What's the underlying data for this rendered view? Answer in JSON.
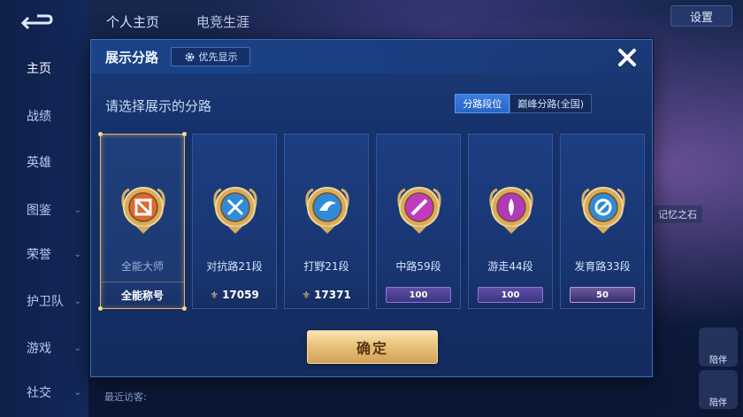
{
  "background": {
    "top_tabs": [
      "个人主页",
      "电竞生涯"
    ],
    "settings_label": "设置",
    "nav_items": [
      {
        "label": "主页",
        "chev": false
      },
      {
        "label": "战绩",
        "chev": false
      },
      {
        "label": "英雄",
        "chev": false
      },
      {
        "label": "图鉴",
        "chev": true
      },
      {
        "label": "荣誉",
        "chev": true
      },
      {
        "label": "护卫队",
        "chev": true
      },
      {
        "label": "游戏",
        "chev": true
      },
      {
        "label": "社交",
        "chev": true
      }
    ],
    "recent_visitors": "最近访客:",
    "right_note": "记忆之石",
    "right_buttons": [
      "陪伴",
      "陪伴"
    ]
  },
  "modal": {
    "title": "展示分路",
    "priority_label": "优先显示",
    "subtitle": "请选择展示的分路",
    "segments": [
      {
        "label": "分路段位",
        "active": true
      },
      {
        "label": "巅峰分路(全国)",
        "active": false
      }
    ],
    "confirm_label": "确定",
    "cards": [
      {
        "name": "全能大师",
        "foot": "全能称号",
        "foot_type": "text",
        "selected": true,
        "emblem": "all-round-master-emblem",
        "color": "#e0672d"
      },
      {
        "name": "对抗路21段",
        "foot": "17059",
        "foot_type": "score",
        "selected": false,
        "emblem": "clash-lane-emblem",
        "color": "#2f8bd8"
      },
      {
        "name": "打野21段",
        "foot": "17371",
        "foot_type": "score",
        "selected": false,
        "emblem": "jungle-emblem",
        "color": "#2f8bd8"
      },
      {
        "name": "中路59段",
        "foot": "100",
        "foot_type": "badge",
        "selected": false,
        "emblem": "mid-lane-emblem",
        "color": "#c13bbf"
      },
      {
        "name": "游走44段",
        "foot": "100",
        "foot_type": "badge",
        "selected": false,
        "emblem": "roam-emblem",
        "color": "#b03ab8"
      },
      {
        "name": "发育路33段",
        "foot": "50",
        "foot_type": "badge",
        "selected": false,
        "emblem": "farm-lane-emblem",
        "color": "#2f8bd8"
      }
    ]
  },
  "colors": {
    "modal_bg": "#163169",
    "accent_blue": "#2a65c4",
    "gold": "#e9c27a"
  }
}
